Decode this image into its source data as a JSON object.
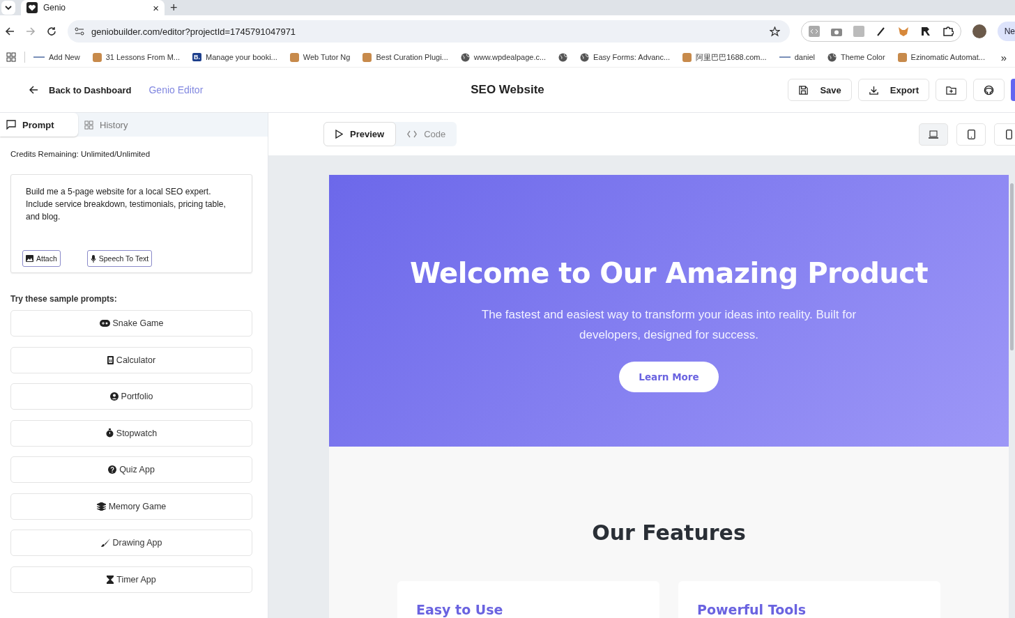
{
  "browser": {
    "tab_title": "Genio",
    "new_tab": "+",
    "close": "×",
    "url": "geniobuilder.com/editor?projectId=1745791047971",
    "profile_chip": "Ne",
    "bookmarks": [
      {
        "label": "Add New",
        "kind": "dash"
      },
      {
        "label": "31 Lessons From M...",
        "kind": "mark"
      },
      {
        "label": "Manage your booki...",
        "kind": "letter",
        "glyph": "B."
      },
      {
        "label": "Web Tutor Ng",
        "kind": "mark"
      },
      {
        "label": "Best Curation Plugi...",
        "kind": "mark"
      },
      {
        "label": "www.wpdealpage.c...",
        "kind": "globe"
      },
      {
        "kind": "globe"
      },
      {
        "label": "Easy Forms: Advanc...",
        "kind": "globe"
      },
      {
        "label": "阿里巴巴1688.com...",
        "kind": "mark"
      },
      {
        "label": "daniel",
        "kind": "dash"
      },
      {
        "label": "Theme Color",
        "kind": "globe"
      },
      {
        "label": "Ezinomatic Automat...",
        "kind": "mark"
      }
    ],
    "more": "»"
  },
  "header": {
    "back": "Back to Dashboard",
    "brand": "Genio Editor",
    "title": "SEO Website",
    "actions": [
      {
        "label": "Save",
        "kind": "save"
      },
      {
        "label": "Export",
        "kind": "export"
      },
      {
        "kind": "folder"
      },
      {
        "kind": "github"
      }
    ]
  },
  "sidebar": {
    "tabs": [
      {
        "label": "Prompt",
        "kind": "chat",
        "selected": true
      },
      {
        "label": "History",
        "kind": "grid",
        "selected": false
      }
    ],
    "credits": "Credits Remaining: Unlimited/Unlimited",
    "prompt": "Build me a 5-page website for a local SEO expert. Include service breakdown, testimonials, pricing table, and blog.",
    "attach": "Attach",
    "speech": "Speech To Text",
    "samples_title": "Try these sample prompts:",
    "samples": [
      {
        "label": "Snake Game",
        "kind": "gamepad"
      },
      {
        "label": "Calculator",
        "kind": "calculator"
      },
      {
        "label": "Portfolio",
        "kind": "user"
      },
      {
        "label": "Stopwatch",
        "kind": "stopwatch"
      },
      {
        "label": "Quiz App",
        "kind": "question"
      },
      {
        "label": "Memory Game",
        "kind": "layers"
      },
      {
        "label": "Drawing App",
        "kind": "brush"
      },
      {
        "label": "Timer App",
        "kind": "hourglass"
      }
    ]
  },
  "view_tabs": [
    {
      "label": "Preview",
      "kind": "play",
      "selected": true
    },
    {
      "label": "Code",
      "kind": "code",
      "selected": false
    }
  ],
  "devices": [
    {
      "kind": "laptop",
      "selected": true
    },
    {
      "kind": "tablet",
      "selected": false
    },
    {
      "kind": "phone",
      "selected": false
    }
  ],
  "preview": {
    "hero_title": "Welcome to Our Amazing Product",
    "hero_text": "The fastest and easiest way to transform your ideas into reality. Built for developers, designed for success.",
    "cta": "Learn More",
    "features_title": "Our Features",
    "features": [
      "Easy to Use",
      "Powerful Tools"
    ]
  }
}
